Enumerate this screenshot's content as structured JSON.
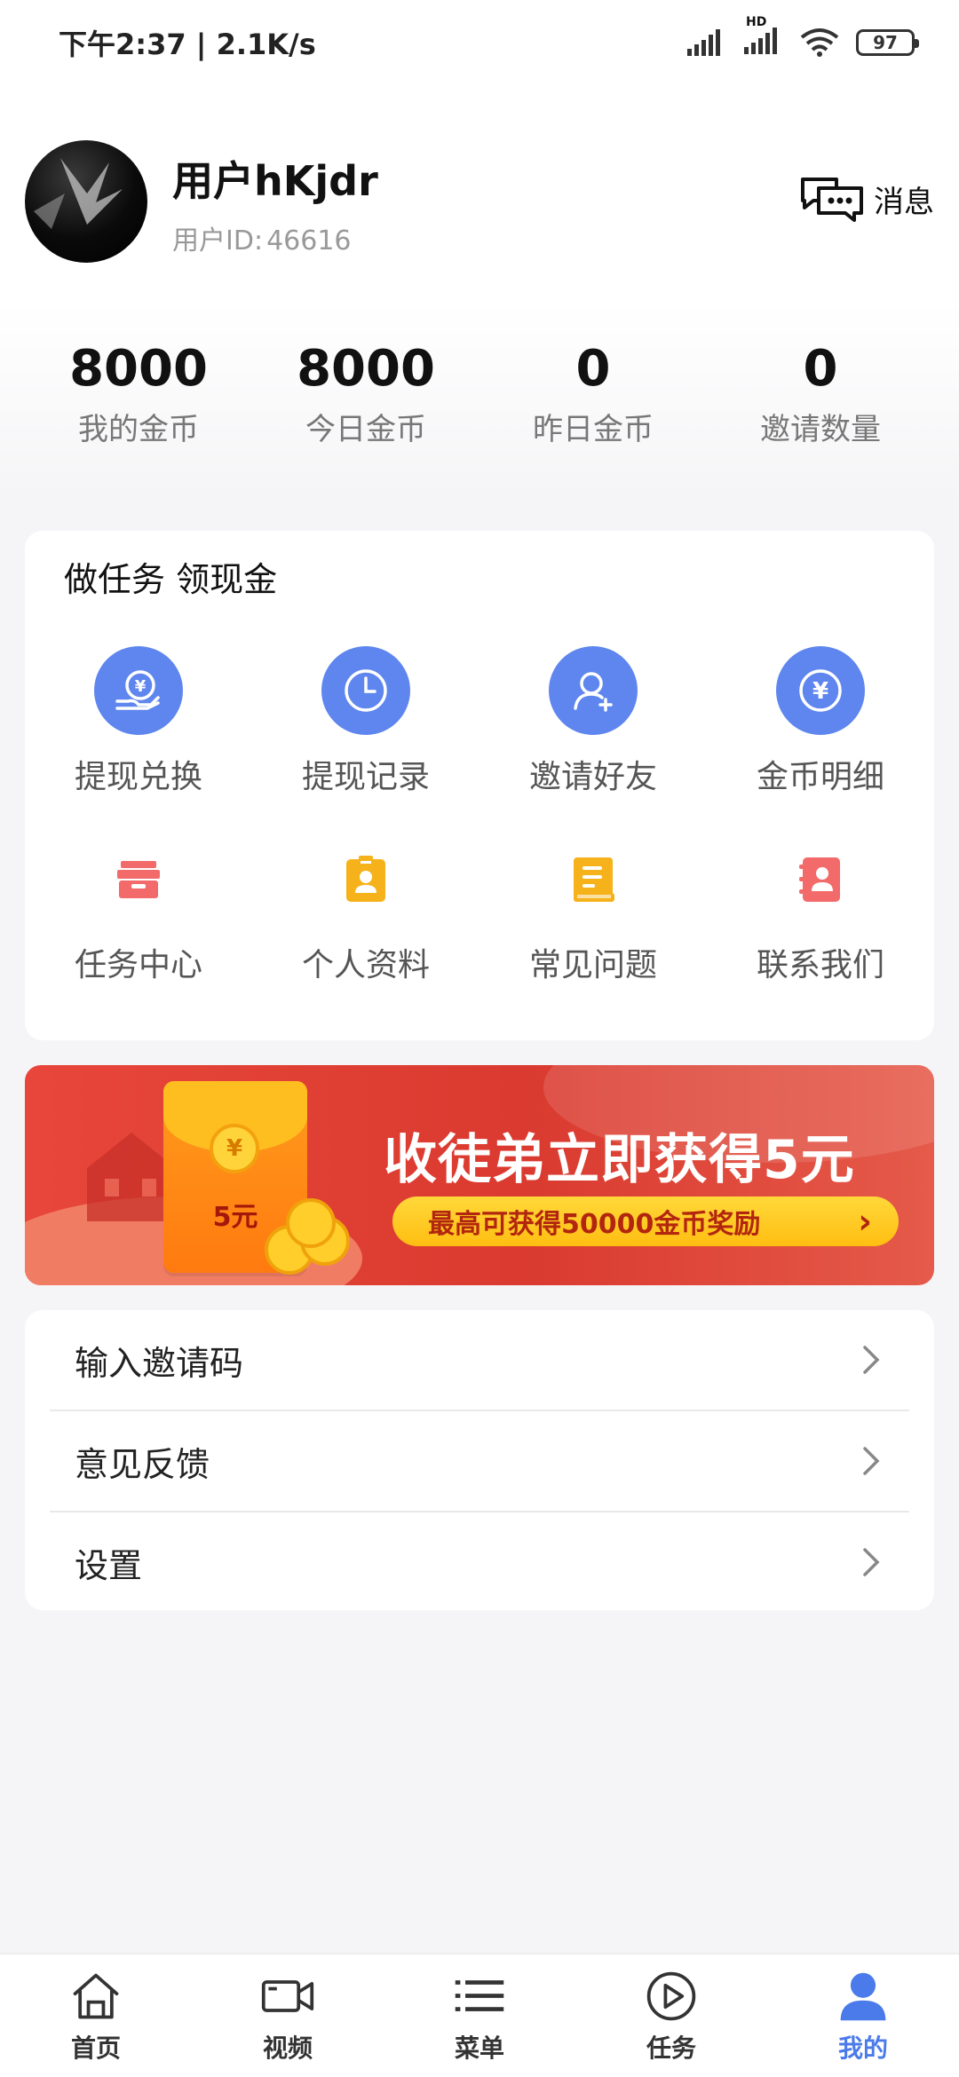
{
  "status_bar": {
    "time_speed": "下午2:37 | 2.1K/s",
    "network_badge": "HD",
    "battery": "97"
  },
  "profile": {
    "username": "用户hKjdr",
    "user_id_label": "用户ID:",
    "user_id": "46616",
    "message_label": "消息"
  },
  "stats": [
    {
      "value": "8000",
      "label": "我的金币"
    },
    {
      "value": "8000",
      "label": "今日金币"
    },
    {
      "value": "0",
      "label": "昨日金币"
    },
    {
      "value": "0",
      "label": "邀请数量"
    }
  ],
  "tasks": {
    "title": "做任务 领现金",
    "items": [
      {
        "label": "提现兑换",
        "icon": "withdraw-exchange-icon"
      },
      {
        "label": "提现记录",
        "icon": "clock-icon"
      },
      {
        "label": "邀请好友",
        "icon": "add-friend-icon"
      },
      {
        "label": "金币明细",
        "icon": "yen-coin-icon"
      },
      {
        "label": "任务中心",
        "icon": "task-box-icon"
      },
      {
        "label": "个人资料",
        "icon": "profile-card-icon"
      },
      {
        "label": "常见问题",
        "icon": "faq-book-icon"
      },
      {
        "label": "联系我们",
        "icon": "contact-book-icon"
      }
    ]
  },
  "banner": {
    "envelope_amount": "5元",
    "coin_symbol": "¥",
    "headline": "收徒弟立即获得5元",
    "subline": "最高可获得50000金币奖励"
  },
  "menu": [
    {
      "label": "输入邀请码"
    },
    {
      "label": "意见反馈"
    },
    {
      "label": "设置"
    }
  ],
  "tabbar": [
    {
      "label": "首页",
      "icon": "home-icon"
    },
    {
      "label": "视频",
      "icon": "video-camera-icon"
    },
    {
      "label": "菜单",
      "icon": "menu-list-icon"
    },
    {
      "label": "任务",
      "icon": "play-circle-icon"
    },
    {
      "label": "我的",
      "icon": "user-icon",
      "active": true
    }
  ],
  "colors": {
    "accent_blue": "#5f86ee",
    "active_tab": "#4b7bea",
    "banner_red": "#da3a2f",
    "task_red": "#f26a6a",
    "task_yellow": "#f6b21b"
  }
}
